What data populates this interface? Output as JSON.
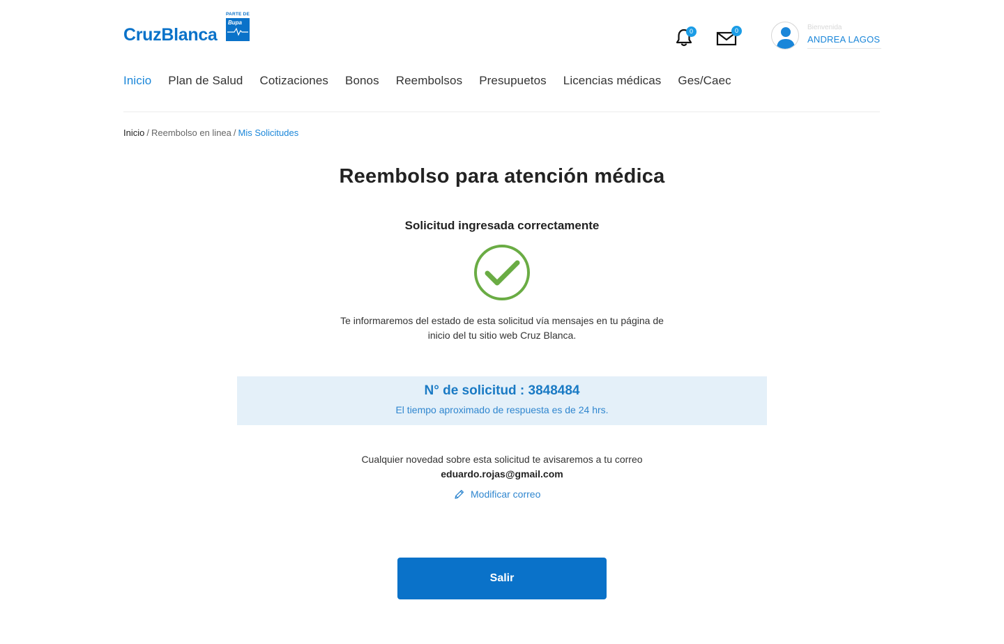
{
  "brand": {
    "name": "CruzBlanca",
    "badge_top": "PARTE DE",
    "badge_name": "Bupa",
    "brand_color": "#0a72c9"
  },
  "header": {
    "notifications_count": "0",
    "messages_count": "0",
    "welcome_label": "Bienvenida",
    "user_name": "ANDREA LAGOS"
  },
  "nav": {
    "items": [
      {
        "label": "Inicio",
        "active": true
      },
      {
        "label": "Plan de Salud",
        "active": false
      },
      {
        "label": "Cotizaciones",
        "active": false
      },
      {
        "label": "Bonos",
        "active": false
      },
      {
        "label": "Reembolsos",
        "active": false
      },
      {
        "label": "Presupuetos",
        "active": false
      },
      {
        "label": "Licencias médicas",
        "active": false
      },
      {
        "label": "Ges/Caec",
        "active": false
      }
    ]
  },
  "breadcrumb": {
    "home": "Inicio",
    "middle": "Reembolso en linea",
    "current": "Mis Solicitudes"
  },
  "main": {
    "title": "Reembolso para atención médica",
    "subtitle": "Solicitud ingresada correctamente",
    "status_icon": "check-circle-icon",
    "info_line1": "Te informaremos del estado de esta solicitud vía mensajes en tu página de",
    "info_line2": "inicio del tu sitio web Cruz Blanca.",
    "request_label": "N° de solicitud : 3848484",
    "response_time": "El tiempo aproximado de respuesta es de 24 hrs.",
    "notice": "Cualquier novedad sobre esta solicitud te avisaremos a tu correo",
    "email": "eduardo.rojas@gmail.com",
    "modify_label": "Modificar correo",
    "exit_label": "Salir"
  },
  "colors": {
    "accent": "#1a86d9",
    "success": "#6aac44",
    "info_bg": "#e4f0f9"
  }
}
